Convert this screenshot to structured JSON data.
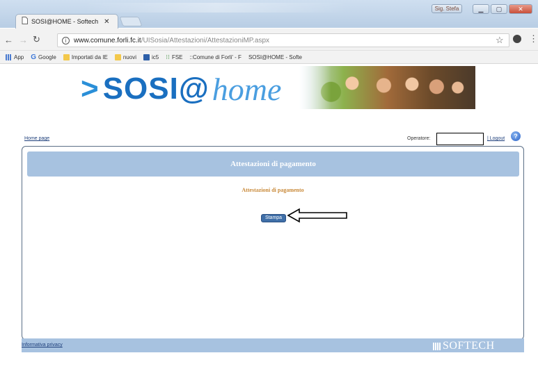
{
  "browser": {
    "tab_title": "SOSI@HOME - Softech",
    "url_host": "www.comune.forli.fc.it",
    "url_path": "/UISosia/Attestazioni/AttestazioniMP.aspx",
    "user_chip": "Sig. Stefa"
  },
  "bookmarks": [
    {
      "label": "App",
      "icon": "apps-icon"
    },
    {
      "label": "Google",
      "icon": "google-icon"
    },
    {
      "label": "Importati da IE",
      "icon": "folder-icon"
    },
    {
      "label": "nuovi",
      "icon": "folder-icon"
    },
    {
      "label": "ic5",
      "icon": "bookmark-icon"
    },
    {
      "label": "FSE",
      "icon": "fse-icon"
    },
    {
      "label": "::Comune di Forli' - F",
      "icon": "page-icon"
    },
    {
      "label": "SOSI@HOME - Softe",
      "icon": "page-icon"
    }
  ],
  "header": {
    "logo_prefix": ">",
    "logo_sosi": "SOSI@",
    "logo_home": "home"
  },
  "toplinks": {
    "home": "Home page",
    "operator_label": "Operatore:",
    "logout": "| Logout"
  },
  "main": {
    "title": "Attestazioni di pagamento",
    "subtitle": "Attestazioni di pagamento",
    "print_button": "Stampa"
  },
  "footer": {
    "privacy": "Informativa privacy",
    "brand": "SOFTECH"
  },
  "colors": {
    "panel_header": "#a7c2e0",
    "subtitle": "#c98a3a",
    "button": "#3f6fa8"
  }
}
